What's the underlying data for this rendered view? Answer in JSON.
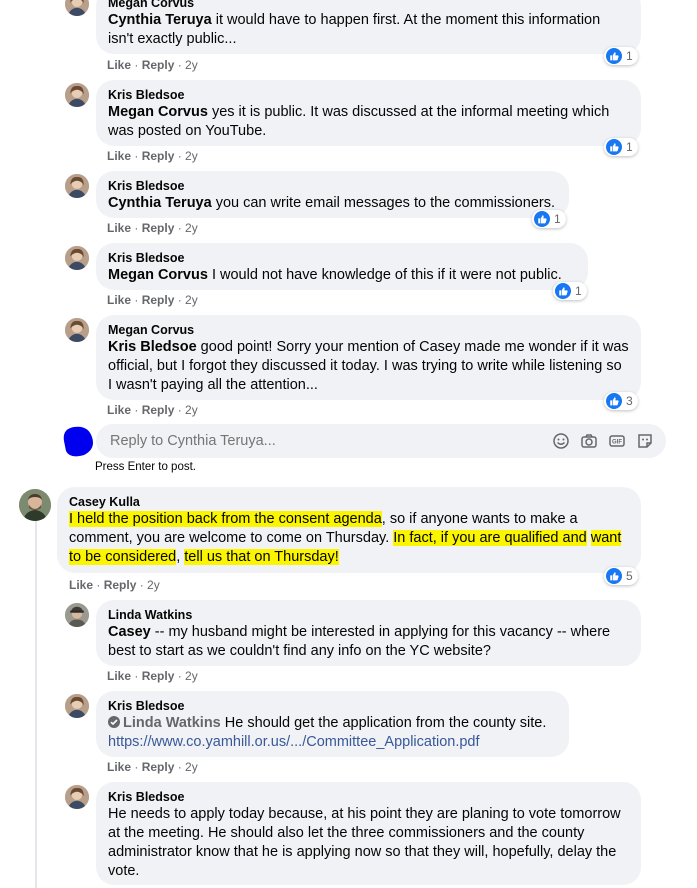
{
  "comments": [
    {
      "author": "Megan Corvus",
      "mention": "Cynthia Teruya",
      "text": " it would have to happen first. At the moment this information isn't exactly public...",
      "actions": {
        "like": "Like",
        "reply": "Reply",
        "time": "2y"
      },
      "reactions": "1"
    },
    {
      "author": "Kris Bledsoe",
      "mention": "Megan Corvus",
      "text": " yes it is public. It was discussed at the informal meeting which was posted on YouTube.",
      "actions": {
        "like": "Like",
        "reply": "Reply",
        "time": "2y"
      },
      "reactions": "1"
    },
    {
      "author": "Kris Bledsoe",
      "mention": "Cynthia Teruya",
      "text": " you can write email messages to the commissioners.",
      "actions": {
        "like": "Like",
        "reply": "Reply",
        "time": "2y"
      },
      "reactions": "1"
    },
    {
      "author": "Kris Bledsoe",
      "mention": "Megan Corvus",
      "text": " I would not have knowledge of this if it were not public.",
      "actions": {
        "like": "Like",
        "reply": "Reply",
        "time": "2y"
      },
      "reactions": "1"
    },
    {
      "author": "Megan Corvus",
      "mention": "Kris Bledsoe",
      "text": " good point! Sorry your mention of Casey made me wonder if it was official, but I forgot they discussed it today. I was trying to write while listening so I wasn't paying all the attention...",
      "actions": {
        "like": "Like",
        "reply": "Reply",
        "time": "2y"
      },
      "reactions": "3"
    }
  ],
  "reply_box": {
    "placeholder": "Reply to Cynthia Teruya...",
    "hint": "Press Enter to post."
  },
  "main_comment": {
    "author": "Casey Kulla",
    "hl1": "I held the position back from the consent agenda",
    "mid1": ", so if anyone wants to make a comment, you are welcome to come on Thursday. ",
    "hl2a": "In fact, if you are qualified and",
    "hl2b": "want to be considered",
    "mid2": ", ",
    "hl3": "tell us that on Thursday!",
    "actions": {
      "like": "Like",
      "reply": "Reply",
      "time": "2y"
    },
    "reactions": "5"
  },
  "replies": [
    {
      "author": "Linda Watkins",
      "mention": "Casey",
      "text": " -- my husband might be interested in applying for this vacancy -- where best to start as we couldn't find any info on the YC website?",
      "actions": {
        "like": "Like",
        "reply": "Reply",
        "time": "2y"
      }
    },
    {
      "author": "Kris Bledsoe",
      "mention": "Linda Watkins",
      "text": " He should get the application from the county site.",
      "link": "https://www.co.yamhill.or.us/.../Committee_Application.pdf",
      "actions": {
        "like": "Like",
        "reply": "Reply",
        "time": "2y"
      }
    },
    {
      "author": "Kris Bledsoe",
      "text": "He needs to apply today because, at his point they are planing to vote tomorrow at the meeting. He should also let the three commissioners and the county administrator know that he is applying now so that they will, hopefully, delay the vote."
    }
  ],
  "colors": {
    "like_blue": "#1877f2",
    "bubble": "#f0f2f5",
    "highlight": "#fbf500",
    "meta": "#65676b"
  }
}
